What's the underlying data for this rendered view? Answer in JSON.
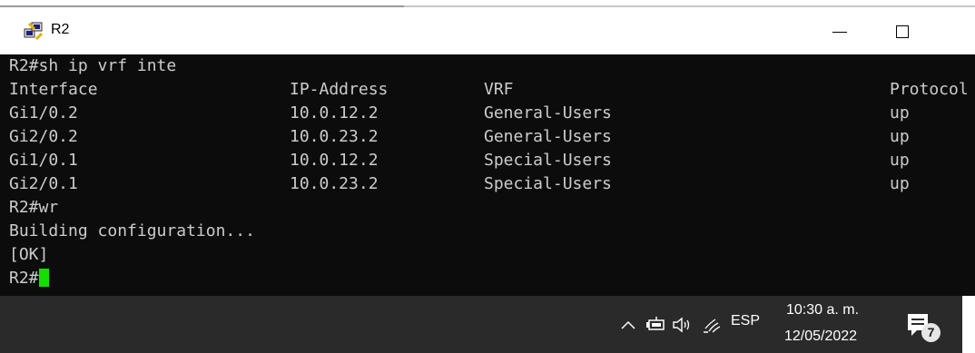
{
  "window": {
    "title": "R2"
  },
  "terminal": {
    "command1": "R2#sh ip vrf inte",
    "headers": [
      "Interface",
      "IP-Address",
      "VRF",
      "Protocol"
    ],
    "rows": [
      [
        "Gi1/0.2",
        "10.0.12.2",
        "General-Users",
        "up"
      ],
      [
        "Gi2/0.2",
        "10.0.23.2",
        "General-Users",
        "up"
      ],
      [
        "Gi1/0.1",
        "10.0.12.2",
        "Special-Users",
        "up"
      ],
      [
        "Gi2/0.1",
        "10.0.23.2",
        "Special-Users",
        "up"
      ]
    ],
    "command2": "R2#wr",
    "output1": "Building configuration...",
    "output2": "[OK]",
    "prompt": "R2#"
  },
  "taskbar": {
    "language": "ESP",
    "time": "10:30 a. m.",
    "date": "12/05/2022",
    "notification_count": "7"
  },
  "colors": {
    "terminal_bg": "#0c0c0c",
    "terminal_text": "#cccccc",
    "cursor": "#13e000",
    "taskbar_bg": "#2a2a2a"
  },
  "icons": [
    "putty-icon",
    "minimize-icon",
    "maximize-icon",
    "chevron-up-icon",
    "battery-icon",
    "volume-icon",
    "wifi-icon",
    "notification-icon"
  ]
}
